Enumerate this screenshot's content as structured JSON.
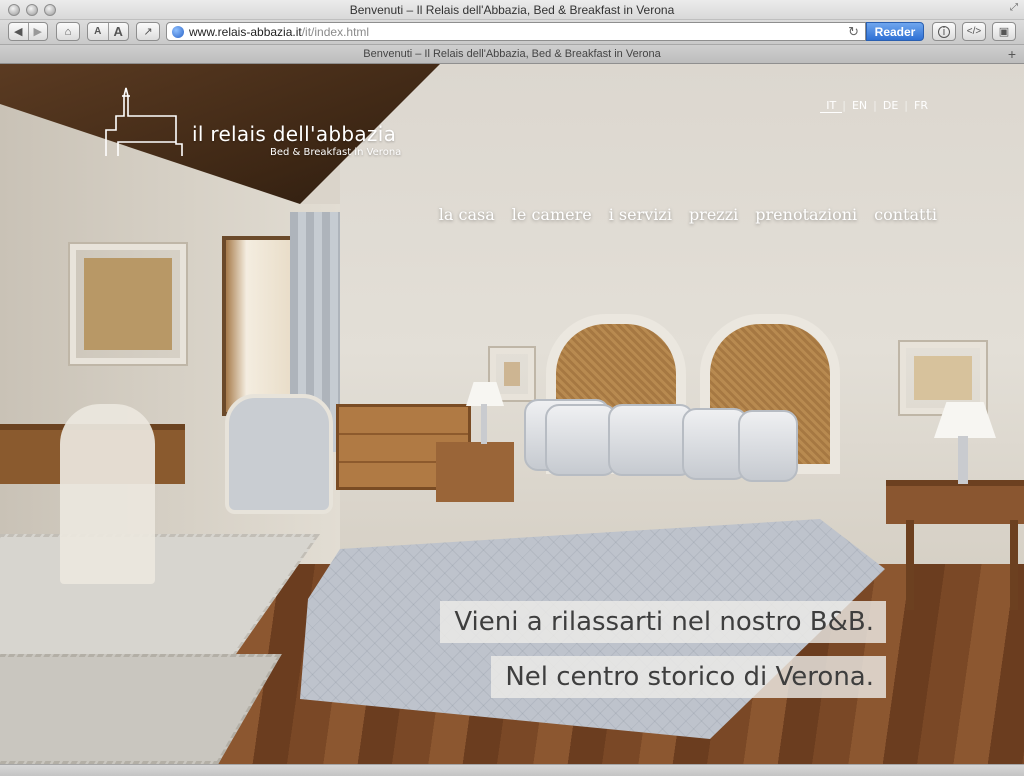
{
  "window": {
    "title": "Benvenuti – Il Relais dell'Abbazia, Bed & Breakfast in Verona"
  },
  "toolbar": {
    "back_icon": "back-arrow-icon",
    "forward_icon": "forward-arrow-icon",
    "home_icon": "home-icon",
    "text_small": "A",
    "text_large": "A",
    "share_icon": "share-icon",
    "url_host": "www.relais-abbazia.it",
    "url_path": "/it/index.html",
    "reload_icon": "reload-icon",
    "reader_label": "Reader",
    "right_icons": [
      "info-icon",
      "source-icon",
      "screenshot-icon"
    ]
  },
  "tab": {
    "title": "Benvenuti – Il Relais dell'Abbazia, Bed & Breakfast in Verona",
    "add_icon": "add-tab-icon"
  },
  "site": {
    "logo_text": "il relais dell'abbazia",
    "logo_sub": "Bed & Breakfast in Verona",
    "languages": [
      {
        "code": "IT",
        "active": true
      },
      {
        "code": "EN",
        "active": false
      },
      {
        "code": "DE",
        "active": false
      },
      {
        "code": "FR",
        "active": false
      }
    ],
    "nav": [
      "la casa",
      "le camere",
      "i servizi",
      "prezzi",
      "prenotazioni",
      "contatti"
    ],
    "tagline_1": "Vieni a rilassarti nel nostro B&B.",
    "tagline_2": "Nel centro storico di Verona."
  },
  "colors": {
    "reader_blue": "#3a7ad9",
    "tagline_bg": "#eeece8",
    "nav_text": "#ffffff"
  }
}
